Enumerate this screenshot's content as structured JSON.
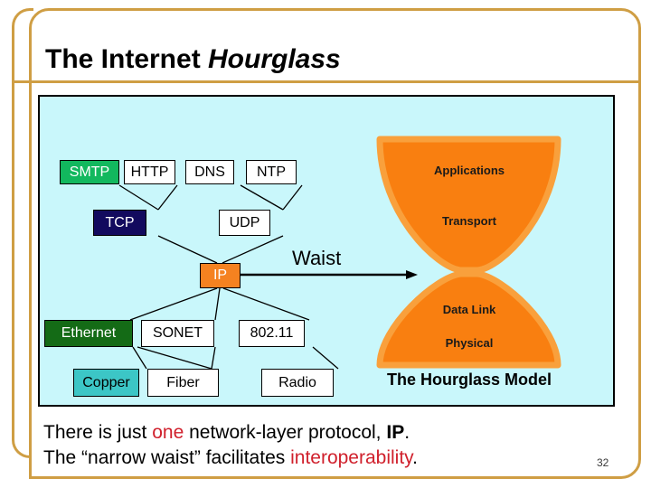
{
  "slide": {
    "title_plain": "The Internet ",
    "title_italic": "Hourglass",
    "page_number": "32"
  },
  "diagram": {
    "protocol_boxes": [
      {
        "label": "SMTP",
        "style": "green"
      },
      {
        "label": "HTTP",
        "style": "white"
      },
      {
        "label": "DNS",
        "style": "white"
      },
      {
        "label": "NTP",
        "style": "white"
      },
      {
        "label": "TCP",
        "style": "navy"
      },
      {
        "label": "UDP",
        "style": "white"
      },
      {
        "label": "IP",
        "style": "orange"
      },
      {
        "label": "Ethernet",
        "style": "dgreen"
      },
      {
        "label": "SONET",
        "style": "white"
      },
      {
        "label": "802.11",
        "style": "white"
      },
      {
        "label": "Copper",
        "style": "teal"
      },
      {
        "label": "Fiber",
        "style": "white"
      },
      {
        "label": "Radio",
        "style": "white"
      }
    ],
    "waist_label": "Waist",
    "hourglass": {
      "fill": "#f97f10",
      "outline": "#f9a03c",
      "layers": [
        "Applications",
        "Transport",
        "Data Link",
        "Physical"
      ],
      "caption": "The Hourglass Model"
    },
    "panel_background": "#c9f7fb"
  },
  "caption": {
    "line1_a": "There is just ",
    "line1_b": "one",
    "line1_c": " network-layer protocol, ",
    "line1_d": "IP",
    "line1_e": ".",
    "line2_a": "The “narrow waist” facilitates ",
    "line2_b": "interoperability",
    "line2_c": "."
  },
  "colors": {
    "frame": "#cf9e44",
    "accent_red": "#d0202c",
    "orange": "#f58220"
  }
}
